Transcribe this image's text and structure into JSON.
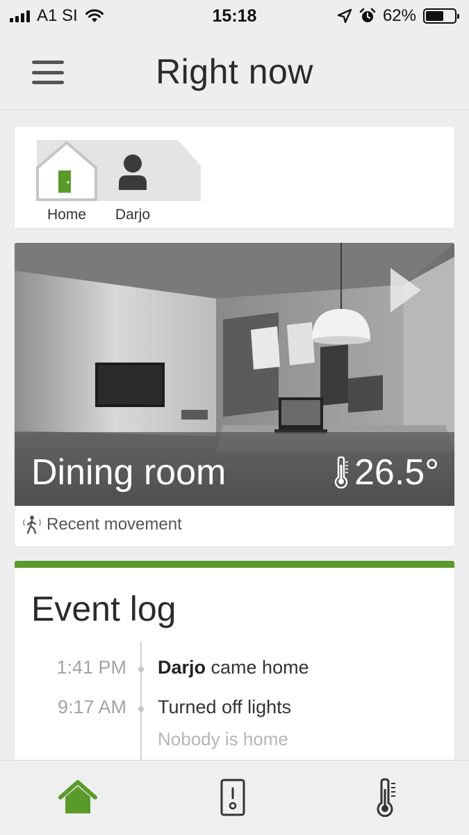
{
  "status_bar": {
    "carrier": "A1 SI",
    "time": "15:18",
    "battery_percent": "62%",
    "battery_level": 0.62,
    "icons": [
      "signal-icon",
      "wifi-icon",
      "location-icon",
      "alarm-icon",
      "battery-icon"
    ]
  },
  "header": {
    "title": "Right now",
    "menu_icon": "hamburger-menu-icon"
  },
  "presence": {
    "items": [
      {
        "label": "Home",
        "icon": "house-icon",
        "door_color": "#5a9a2b"
      },
      {
        "label": "Darjo",
        "icon": "person-icon"
      }
    ]
  },
  "camera": {
    "room": "Dining room",
    "temperature": "26.5°",
    "status": "Recent movement",
    "icons": [
      "play-icon",
      "thermometer-icon",
      "motion-icon"
    ]
  },
  "event_log": {
    "title": "Event log",
    "accent_color": "#5a9a2b",
    "events": [
      {
        "time": "1:41 PM",
        "name": "Darjo",
        "text": " came home"
      },
      {
        "time": "9:17 AM",
        "text": "Turned off lights",
        "subtext": "Nobody is home"
      }
    ]
  },
  "tab_bar": {
    "tabs": [
      {
        "name": "home",
        "icon": "home-icon",
        "active": true,
        "color": "#5a9a2b"
      },
      {
        "name": "switch",
        "icon": "light-switch-icon",
        "active": false
      },
      {
        "name": "climate",
        "icon": "thermometer-icon",
        "active": false
      }
    ]
  }
}
